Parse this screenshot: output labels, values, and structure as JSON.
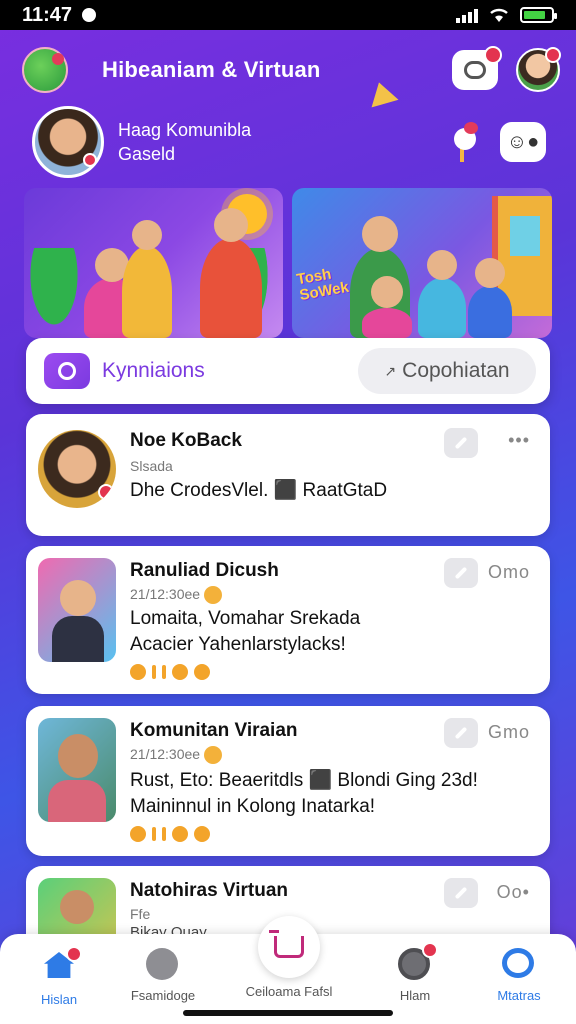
{
  "status_bar": {
    "time": "11:47"
  },
  "header": {
    "title": "Hibeaniam & Virtuan"
  },
  "profile": {
    "line1": "Haag Komunibla",
    "line2": "Gaseld"
  },
  "tabs": {
    "active_label": "Kynniaions",
    "secondary_label": "Copohiatan"
  },
  "feed": [
    {
      "title": "Noe KoBack",
      "subtitle": "Slsada",
      "body": "Dhe CrodesVlel. ⬛ RaatGtaD"
    },
    {
      "title": "Ranuliad Dicush",
      "subtitle": "21/12:30ee",
      "body_line1": "Lomaita, Vomahar Srekada",
      "body_line2": "Acacier Yahenlarstylacks!",
      "more": "Omo"
    },
    {
      "title": "Komunitan Viraian",
      "subtitle": "21/12:30ee",
      "body_line1": "Rust, Eto: Beaeritdls ⬛ Blondi Ging 23d!",
      "body_line2": "Maininnul in Kolong Inatarka!",
      "more": "Gmo"
    },
    {
      "title": "Natohiras Virtuan",
      "subtitle": "Ffe",
      "body": "Bikay Ouay",
      "more": "Oo•"
    }
  ],
  "bottom_nav": [
    {
      "label": "Hislan"
    },
    {
      "label": "Fsamidoge"
    },
    {
      "label": "Ceiloama Fafsl"
    },
    {
      "label": "Hlam"
    },
    {
      "label": "Mtatras"
    }
  ],
  "colors": {
    "accent": "#7b3ae0",
    "nav_active": "#2e7be6",
    "badge": "#e3344f"
  }
}
